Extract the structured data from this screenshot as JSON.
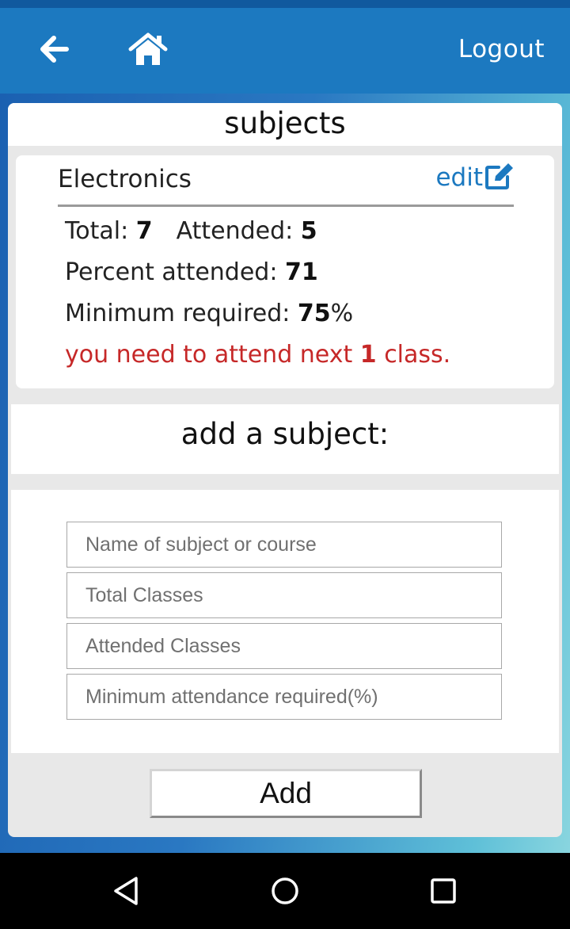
{
  "header": {
    "back_icon": "arrow-left-icon",
    "home_icon": "home-icon",
    "logout_label": "Logout"
  },
  "page_title": "subjects",
  "subject": {
    "name": "Electronics",
    "edit_label": "edit",
    "edit_icon": "edit-icon",
    "total_label": "Total: ",
    "total_value": "7",
    "attended_label": "Attended: ",
    "attended_value": "5",
    "percent_label": "Percent attended: ",
    "percent_value": "71",
    "minimum_label": "Minimum required: ",
    "minimum_value": "75",
    "minimum_suffix": "%",
    "notice_prefix": "you need to attend next ",
    "notice_count": "1",
    "notice_suffix": " class."
  },
  "add_form": {
    "title": "add a subject:",
    "name_placeholder": "Name of subject or course",
    "total_placeholder": "Total Classes",
    "attended_placeholder": "Attended Classes",
    "minimum_placeholder": "Minimum attendance required(%)",
    "add_label": "Add"
  },
  "colors": {
    "appbar": "#1c79c0",
    "accent": "#1c79c0",
    "warning": "#c62828"
  },
  "navbar": {
    "back_icon": "nav-back-triangle-icon",
    "home_icon": "nav-home-circle-icon",
    "recent_icon": "nav-recent-square-icon"
  }
}
